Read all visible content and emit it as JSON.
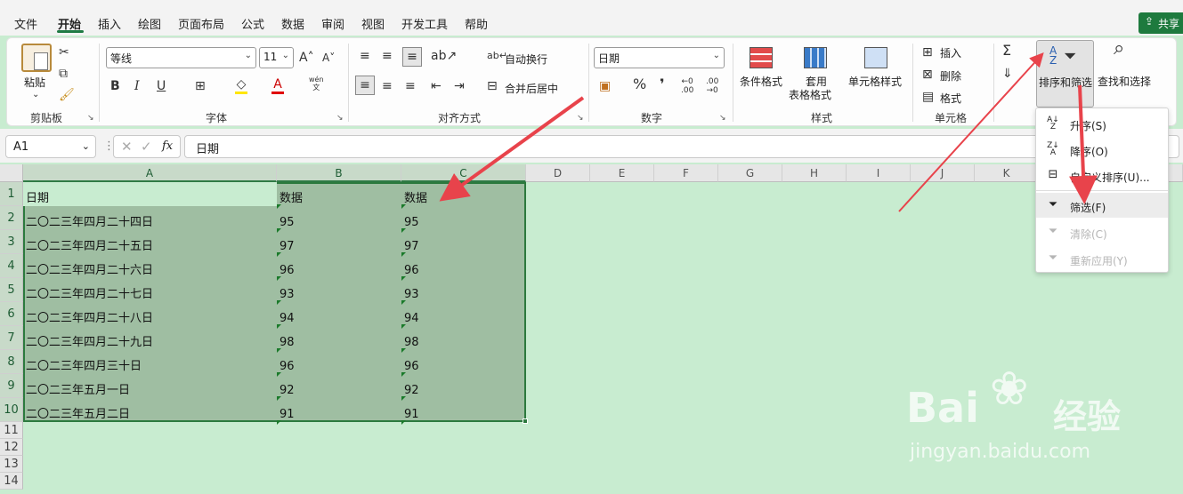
{
  "tabs": [
    "文件",
    "开始",
    "插入",
    "绘图",
    "页面布局",
    "公式",
    "数据",
    "审阅",
    "视图",
    "开发工具",
    "帮助"
  ],
  "share": "共享",
  "ribbon": {
    "clipboard": {
      "paste": "粘贴",
      "label": "剪贴板"
    },
    "font": {
      "name": "等线",
      "size": "11",
      "label": "字体",
      "bold": "B",
      "italic": "I",
      "underline": "U",
      "phonetic": "wén"
    },
    "alignment": {
      "wrap": "自动换行",
      "merge": "合并后居中",
      "label": "对齐方式"
    },
    "number": {
      "format": "日期",
      "percent": "%",
      "comma": "❜",
      "label": "数字"
    },
    "styles": {
      "conditional": "条件格式",
      "table": "套用",
      "table2": "表格格式",
      "cellstyle": "单元格样式",
      "label": "样式"
    },
    "cells": {
      "insert": "插入",
      "delete": "删除",
      "format": "格式",
      "label": "单元格"
    },
    "editing": {
      "sortfilter": "排序和筛选",
      "find": "查找和选择"
    }
  },
  "formula_bar": {
    "namebox": "A1",
    "fx": "fx",
    "content": "日期"
  },
  "columns": [
    "A",
    "B",
    "C",
    "D",
    "E",
    "F",
    "G",
    "H",
    "I",
    "J",
    "K"
  ],
  "rows": [
    "1",
    "2",
    "3",
    "4",
    "5",
    "6",
    "7",
    "8",
    "9",
    "10",
    "11",
    "12",
    "13",
    "14"
  ],
  "table": {
    "header": [
      "日期",
      "数据",
      "数据"
    ],
    "data": [
      [
        "二〇二三年四月二十四日",
        "95",
        "95"
      ],
      [
        "二〇二三年四月二十五日",
        "97",
        "97"
      ],
      [
        "二〇二三年四月二十六日",
        "96",
        "96"
      ],
      [
        "二〇二三年四月二十七日",
        "93",
        "93"
      ],
      [
        "二〇二三年四月二十八日",
        "94",
        "94"
      ],
      [
        "二〇二三年四月二十九日",
        "98",
        "98"
      ],
      [
        "二〇二三年四月三十日",
        "96",
        "96"
      ],
      [
        "二〇二三年五月一日",
        "92",
        "92"
      ],
      [
        "二〇二三年五月二日",
        "91",
        "91"
      ]
    ]
  },
  "sort_menu": {
    "items": [
      {
        "label": "升序(S)",
        "icon": "sort-asc-icon",
        "disabled": false
      },
      {
        "label": "降序(O)",
        "icon": "sort-desc-icon",
        "disabled": false
      },
      {
        "label": "自定义排序(U)...",
        "icon": "custom-sort-icon",
        "disabled": false
      },
      {
        "label": "筛选(F)",
        "icon": "filter-icon",
        "disabled": false
      },
      {
        "label": "清除(C)",
        "icon": "clear-filter-icon",
        "disabled": true
      },
      {
        "label": "重新应用(Y)",
        "icon": "reapply-icon",
        "disabled": true
      }
    ]
  },
  "watermark": {
    "brand_left": "Bai",
    "brand_right": "经验",
    "url": "jingyan.baidu.com"
  },
  "colors": {
    "accent": "#1f7a44",
    "selection": "#9fbea2",
    "sheet_bg": "#c8ecd0",
    "arrow": "#e8434b"
  }
}
